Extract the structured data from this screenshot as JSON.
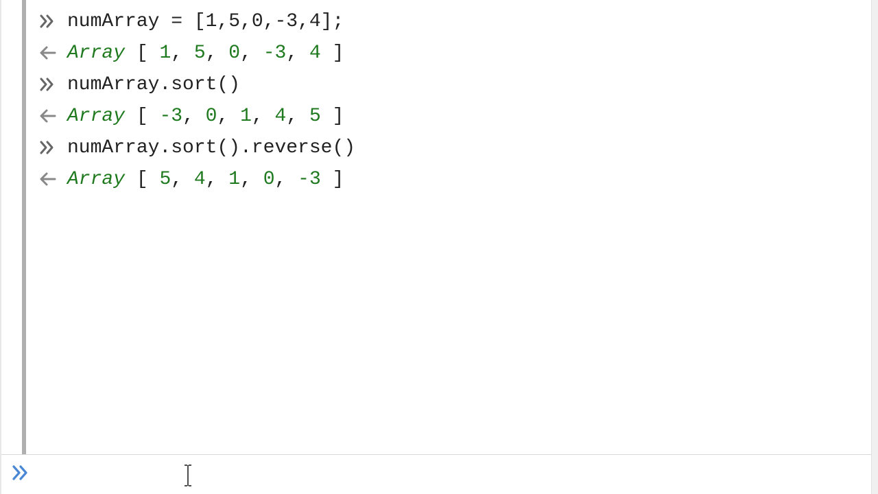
{
  "rows": [
    {
      "kind": "input",
      "code": "numArray = [1,5,0,-3,4];"
    },
    {
      "kind": "output",
      "type": "Array",
      "values": [
        1,
        5,
        0,
        -3,
        4
      ]
    },
    {
      "kind": "input",
      "code": "numArray.sort()"
    },
    {
      "kind": "output",
      "type": "Array",
      "values": [
        -3,
        0,
        1,
        4,
        5
      ]
    },
    {
      "kind": "input",
      "code": "numArray.sort().reverse()"
    },
    {
      "kind": "output",
      "type": "Array",
      "values": [
        5,
        4,
        1,
        0,
        -3
      ]
    }
  ],
  "prompt": {
    "value": ""
  }
}
